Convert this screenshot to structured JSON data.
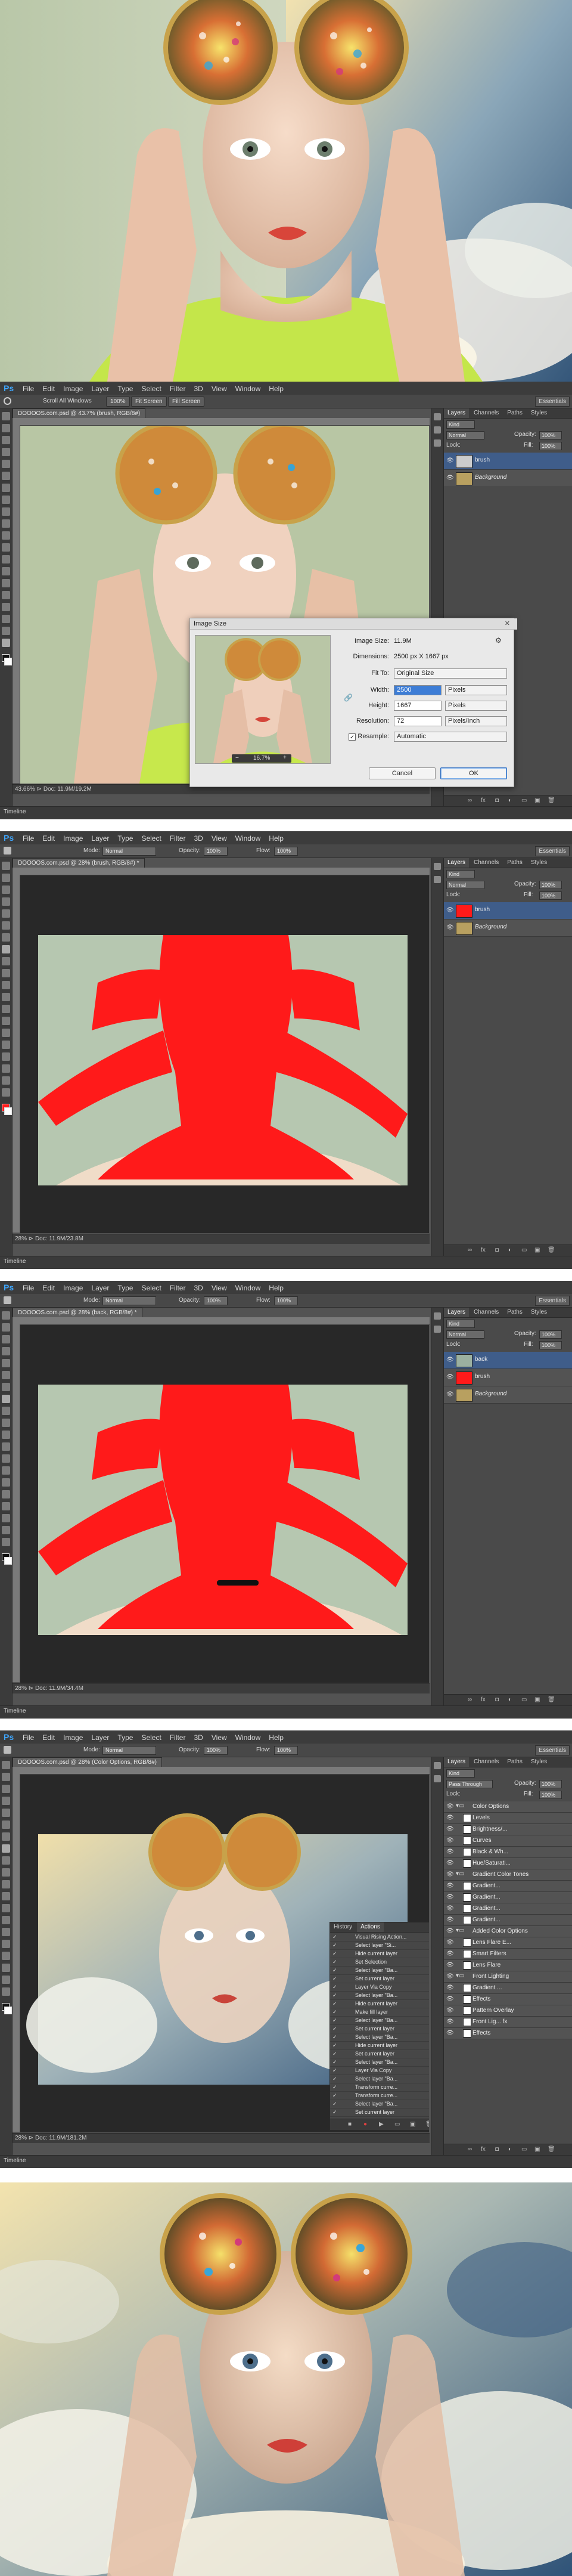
{
  "menu": {
    "logo": "Ps",
    "items": [
      "File",
      "Edit",
      "Image",
      "Layer",
      "Type",
      "Select",
      "Filter",
      "3D",
      "View",
      "Window",
      "Help"
    ]
  },
  "workspace": "Essentials",
  "timeline": "Timeline",
  "options": {
    "mode_label": "Mode:",
    "mode_value": "Normal",
    "opacity_label": "Opacity:",
    "opacity_value": "100%",
    "flow_label": "Flow:",
    "flow_value": "100%",
    "scroll_all": "Scroll All Windows",
    "zoom_100": "100%",
    "fit_screen": "Fit Screen",
    "fill_screen": "Fill Screen"
  },
  "panel_tabs": [
    "Layers",
    "Channels",
    "Paths",
    "Styles"
  ],
  "layers_panel": {
    "kind": "Kind",
    "blend": "Normal",
    "opacity_label": "Opacity:",
    "opacity": "100%",
    "lock_label": "Lock:",
    "fill_label": "Fill:",
    "fill": "100%",
    "blend_step5": "Pass Through"
  },
  "screens": [
    {
      "doc_tab": "DOOOOS.com.psd @ 43.7% (brush, RGB/8#)",
      "status": "43.66%  ⊳  Doc: 11.9M/19.2M",
      "layers": [
        "brush",
        "Background"
      ]
    },
    {
      "doc_tab": "DOOOOS.com.psd @ 28% (brush, RGB/8#) *",
      "status": "28%  ⊳  Doc: 11.9M/23.8M",
      "layers": [
        "brush",
        "Background"
      ]
    },
    {
      "doc_tab": "DOOOOS.com.psd @ 28% (back, RGB/8#) *",
      "status": "28%  ⊳  Doc: 11.9M/34.4M",
      "layers": [
        "back",
        "brush",
        "Background"
      ]
    },
    {
      "doc_tab": "DOOOOS.com.psd @ 28% (Color Options, RGB/8#)",
      "status": "28%  ⊳  Doc: 11.9M/181.2M",
      "layers": [
        "Color Options",
        "Levels",
        "Brightness/...",
        "Curves",
        "Black & Wh...",
        "Hue/Saturati...",
        "Gradient Color Tones",
        "Gradient...",
        "Gradient...",
        "Gradient...",
        "Gradient...",
        "Added Color Options",
        "Lens Flare E...",
        "Smart Filters",
        "Lens Flare",
        "Front Lighting",
        "Gradient ...",
        "Effects",
        "Pattern Overlay",
        "Front Lig... fx",
        "Effects"
      ]
    }
  ],
  "dialog": {
    "title": "Image Size",
    "image_size_label": "Image Size:",
    "image_size_value": "11.9M",
    "dimensions_label": "Dimensions:",
    "dimensions_value": "2500 px  X  1667 px",
    "fit_to_label": "Fit To:",
    "fit_to_value": "Original Size",
    "width_label": "Width:",
    "width_value": "2500",
    "width_unit": "Pixels",
    "height_label": "Height:",
    "height_value": "1667",
    "height_unit": "Pixels",
    "resolution_label": "Resolution:",
    "resolution_value": "72",
    "resolution_unit": "Pixels/Inch",
    "resample_label": "Resample:",
    "resample_value": "Automatic",
    "zoom": "16.7%",
    "cancel": "Cancel",
    "ok": "OK"
  },
  "actions_panel": {
    "tabs": [
      "History",
      "Actions"
    ],
    "items": [
      "Visual Rising Action...",
      "Select layer \"Si...",
      "Hide current layer",
      "Set Selection",
      "Select layer \"Ba...",
      "Set current layer",
      "Layer Via Copy",
      "Select layer \"Ba...",
      "Hide current layer",
      "Make fill layer",
      "Select layer \"Ba...",
      "Set current layer",
      "Select layer \"Ba...",
      "Hide current layer",
      "Set current layer",
      "Select layer \"Ba...",
      "Layer Via Copy",
      "Select layer \"Ba...",
      "Transform curre...",
      "Transform curre...",
      "Select layer \"Ba...",
      "Set current layer"
    ]
  },
  "colors": {
    "ps_blue": "#3fa7ff",
    "brush_red": "#ff1a1a",
    "selected_layer": "#3f5d8a"
  }
}
